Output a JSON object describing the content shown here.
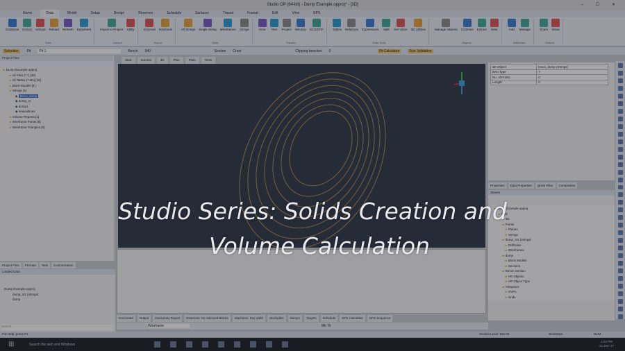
{
  "window": {
    "title": "Studio OP (64-bit) - Dump Example.opproj* - [3D]",
    "right_label": "3D"
  },
  "ribbon_tabs": [
    "Home",
    "Data",
    "Model",
    "Setup",
    "Design",
    "Reserves",
    "Schedule",
    "Surfaces",
    "Transit",
    "Format",
    "Edit",
    "View",
    "EPS"
  ],
  "ribbon_groups": [
    {
      "label": "Data",
      "items": [
        "Database",
        "Extract",
        "Unload",
        "Reload",
        "Refresh",
        "Datasheet"
      ]
    },
    {
      "label": "Convert",
      "items": [
        "Import to Project",
        "Utility"
      ]
    },
    {
      "label": "Export",
      "items": [
        "External",
        "Notebook"
      ]
    },
    {
      "label": "Save",
      "items": [
        "All Strings",
        "Single String",
        "Wireframes",
        "Strings"
      ]
    },
    {
      "label": "Transfer",
      "items": [
        "Vizor",
        "Test",
        "Project",
        "Window",
        "GCS/DRF"
      ]
    },
    {
      "label": "Data Tools",
      "items": [
        "Tables",
        "Relations",
        "Expressions",
        "Split",
        "Set Value",
        "3D Utilities"
      ]
    },
    {
      "label": "Objects",
      "items": [
        "Manage Objects",
        "Combine",
        "Extract",
        "New"
      ]
    },
    {
      "label": "Attributes",
      "items": [
        "Add",
        "Manage"
      ]
    },
    {
      "label": "Shared",
      "items": [
        "Share",
        "Show"
      ]
    }
  ],
  "toolbar": {
    "selection": "Selection",
    "pit_label": "Pit",
    "pit_value": "Pit 1",
    "bench_label": "Bench",
    "bench_value": "940",
    "section_label": "Section",
    "section_value": "Crest",
    "clipping_label": "Clipping benches",
    "clipping_value": "0",
    "pit_calc": "Pit Calculator",
    "run_validation": "Run Validation"
  },
  "project_files": {
    "title": "Project Files",
    "tree": [
      {
        "label": "Dump Example.opproj",
        "level": 0
      },
      {
        "label": "All Files (*.*) [34]",
        "level": 1
      },
      {
        "label": "All Tables (*.dm) [28]",
        "level": 1
      },
      {
        "label": "Block Models [4]",
        "level": 1
      },
      {
        "label": "Strings [4]",
        "level": 1
      },
      {
        "label": "tesco_dump",
        "level": 2,
        "selected": true
      },
      {
        "label": "dump_st",
        "level": 2
      },
      {
        "label": "dump1",
        "level": 2
      },
      {
        "label": "newoutlines",
        "level": 2
      },
      {
        "label": "Volume Reports [1]",
        "level": 1
      },
      {
        "label": "Wireframe Points [8]",
        "level": 1
      },
      {
        "label": "Wireframe Triangles [8]",
        "level": 1
      }
    ]
  },
  "viewport_tabs": [
    "Start",
    "Summit",
    "3D",
    "Plan",
    "Plots",
    "Tests"
  ],
  "left_tabs": [
    "Project Files",
    "Pit Data",
    "Task",
    "Customization"
  ],
  "loaded_data": {
    "title": "Loaded Data",
    "tree": [
      "Dump Example.opproj",
      "dump_st1 (strings)",
      "dump"
    ],
    "search": "Search"
  },
  "properties": {
    "rows": [
      [
        "3D Object",
        "tesco_dump (Strings)"
      ],
      [
        "Item Type",
        "7"
      ],
      [
        "No. of Points",
        "0"
      ],
      [
        "Length",
        "0"
      ]
    ]
  },
  "right_tabs": [
    "Properties",
    "Data Properties",
    "Quick Filter",
    "Composites"
  ],
  "sheets": {
    "title": "Sheets",
    "tree": [
      "Dump Example.opproj",
      "Task",
      "3D",
      "Points",
      "Planes",
      "Strings",
      "dump_st1 (strings)",
      "Drillholes",
      "Wireframes",
      "dump",
      "Block Models",
      "Sections",
      "Bench Section",
      "VR Objects",
      "VR Object Type",
      "Viewpoint",
      "GVPs",
      "Grids"
    ]
  },
  "bottom_tabs": [
    "Command",
    "Output",
    "Dessurvey Report",
    "Reserves: No Selected Blocks",
    "Machines: Key width",
    "Stockpiles",
    "Dumps",
    "Targets",
    "Schedule",
    "EPS Calculator",
    "EPS Sequence"
  ],
  "command_bar": {
    "mode": "Wireframe",
    "snap": "Mk Tri"
  },
  "status": {
    "help": "For Help, press F1",
    "section": "Section Level: 940.00",
    "mode": "WorkDept",
    "num": "NUM"
  },
  "taskbar": {
    "search": "Search the web and Windows",
    "time": "4:03 PM",
    "date": "21-Dec-17"
  },
  "overlay": {
    "line1": "Studio Series: Solids Creation and",
    "line2": "Volume Calculation"
  },
  "colors": {
    "viewport": "#31394a",
    "contour": "#d9a24a",
    "selection": "#3a73c9",
    "highlight": "#f3c86a"
  }
}
